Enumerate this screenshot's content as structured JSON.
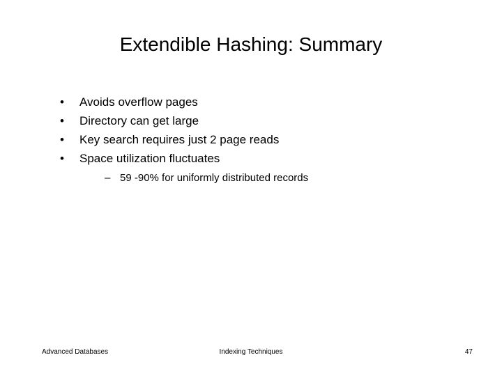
{
  "title": "Extendible Hashing: Summary",
  "bullets": [
    {
      "text": "Avoids overflow pages"
    },
    {
      "text": "Directory can get large"
    },
    {
      "text": "Key search requires just 2 page reads"
    },
    {
      "text": "Space utilization fluctuates"
    }
  ],
  "sub": "59 -90% for uniformly distributed records",
  "footer": {
    "left": "Advanced Databases",
    "center": "Indexing Techniques",
    "right": "47"
  }
}
